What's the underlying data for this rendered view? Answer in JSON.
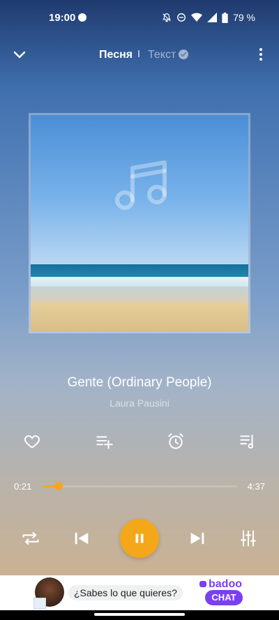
{
  "status_bar": {
    "time": "19:00",
    "battery": "79 %",
    "icons": [
      "mute-icon",
      "dnd-icon",
      "wifi-icon",
      "signal-icon",
      "battery-icon"
    ]
  },
  "header": {
    "tab_song": "Песня",
    "tab_lyrics": "Текст",
    "collapse_icon": "chevron-down-icon",
    "menu_icon": "more-vert-icon"
  },
  "player": {
    "title": "Gente (Ordinary People)",
    "artist": "Laura Pausini",
    "current_time": "0:21",
    "total_time": "4:37",
    "progress": 0.08,
    "accent_color": "#f5a623"
  },
  "actions": [
    "heart-icon",
    "add-to-playlist-icon",
    "alarm-icon",
    "queue-music-icon"
  ],
  "controls": [
    "repeat-icon",
    "previous-icon",
    "pause-icon",
    "next-icon",
    "equalizer-icon"
  ],
  "ad": {
    "text": "¿Sabes lo que quieres?",
    "brand": "badoo",
    "cta": "CHAT",
    "brand_color": "#7b3ff2"
  }
}
